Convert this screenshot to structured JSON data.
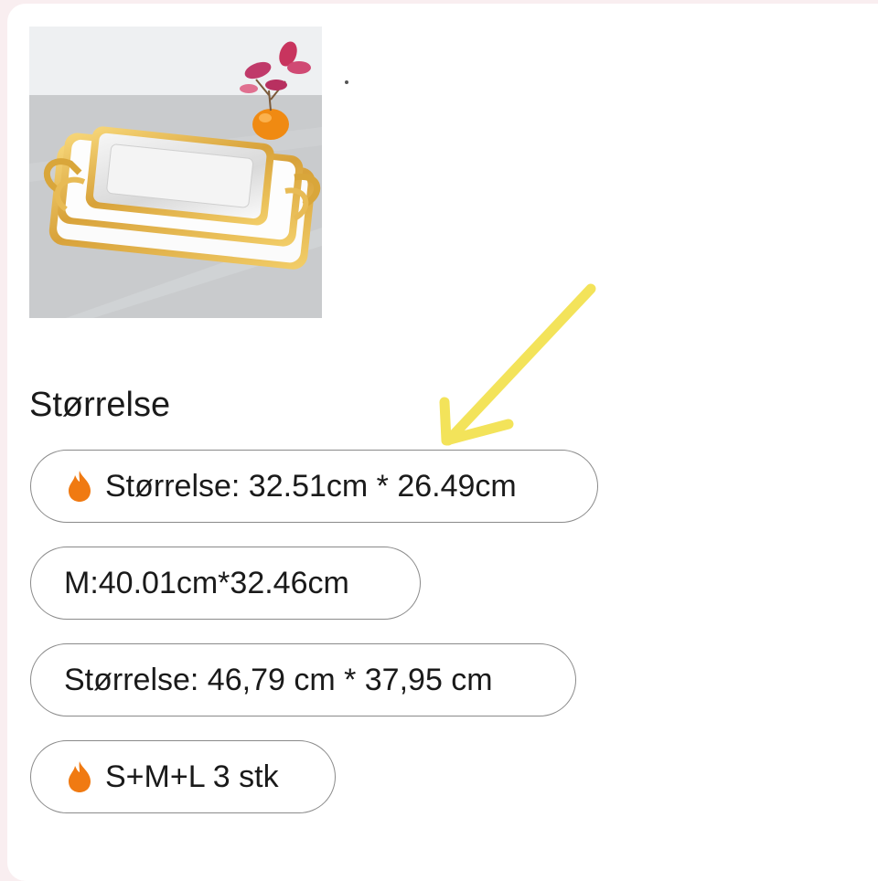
{
  "product_image": {
    "alt": "Gold and silver serving trays set"
  },
  "size_section": {
    "title": "Størrelse",
    "options": [
      {
        "label": "Størrelse: 32.51cm * 26.49cm",
        "icon": "fire-icon",
        "icon_color": "#f07a12"
      },
      {
        "label": "M:40.01cm*32.46cm"
      },
      {
        "label": "Størrelse: 46,79 cm * 37,95 cm"
      },
      {
        "label": "S+M+L 3 stk",
        "icon": "fire-icon",
        "icon_color": "#f07a12"
      }
    ]
  },
  "annotation": {
    "type": "hand-drawn-arrow",
    "color": "#f3e35a"
  }
}
